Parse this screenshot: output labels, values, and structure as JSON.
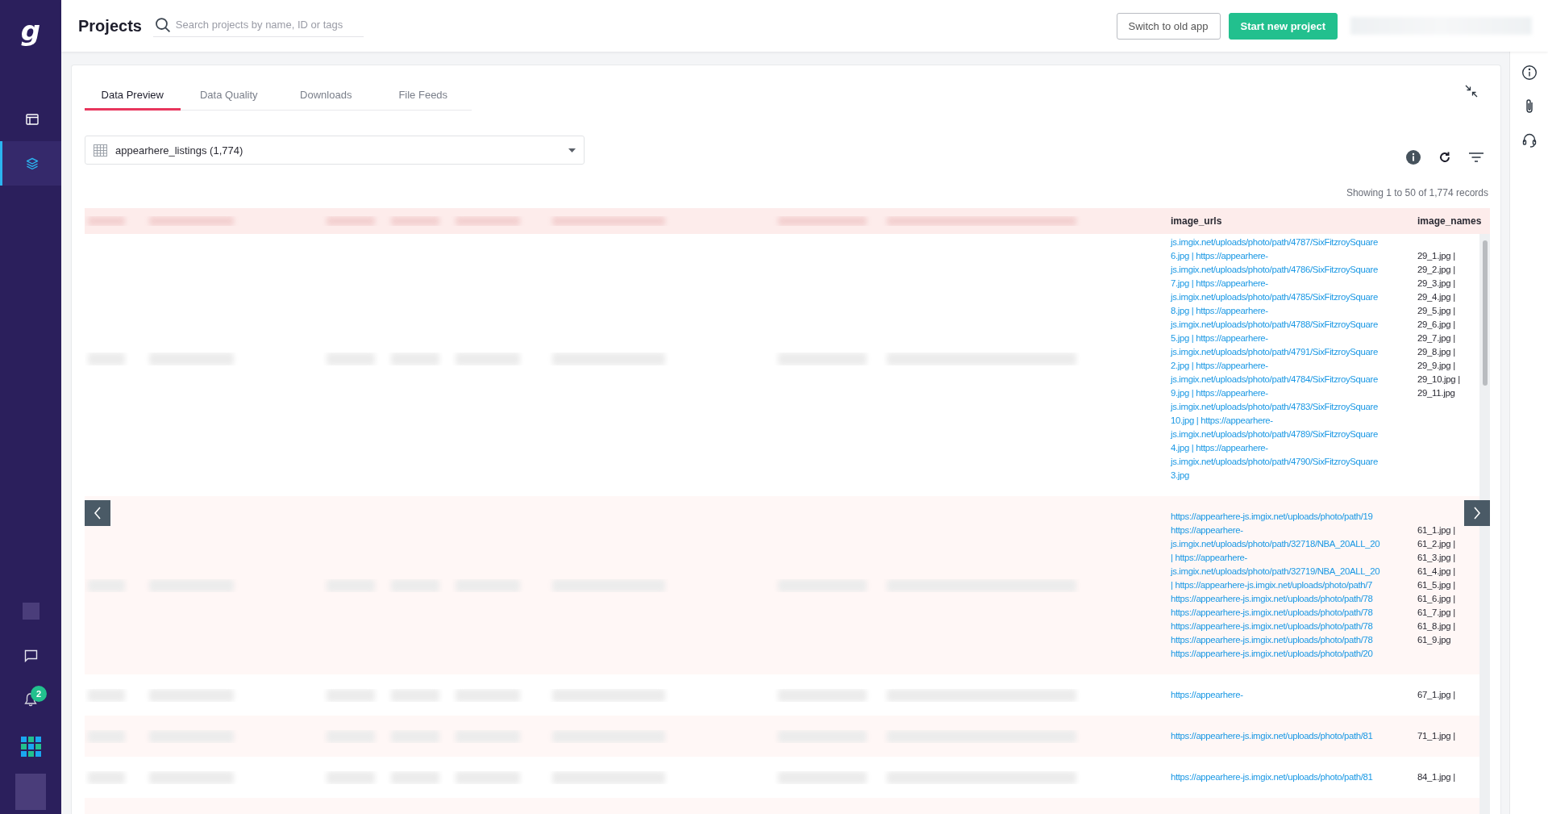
{
  "sidebar": {
    "logo": "g",
    "items": [
      {
        "kind": "layout",
        "selected": false
      },
      {
        "kind": "layers",
        "selected": true
      }
    ],
    "bottom_items": [
      {
        "kind": "photo"
      },
      {
        "kind": "chat"
      },
      {
        "kind": "bell",
        "badge": "2"
      },
      {
        "kind": "apps"
      },
      {
        "kind": "photo"
      }
    ]
  },
  "top_bar": {
    "title": "Projects",
    "search": {
      "placeholder": "Search projects by name, ID or tags"
    },
    "buttons": [
      {
        "label": "Switch to old app",
        "kind": "outline"
      },
      {
        "label": "Start new project",
        "kind": "primary"
      }
    ]
  },
  "tabs": [
    {
      "label": "Data Preview",
      "selected": true
    },
    {
      "label": "Data Quality",
      "selected": false
    },
    {
      "label": "Downloads",
      "selected": false
    },
    {
      "label": "File Feeds",
      "selected": false
    }
  ],
  "dataset_select": {
    "value": "appearhere_listings (1,774)"
  },
  "records_info": "Showing 1 to 50 of 1,774 records",
  "table": {
    "columns": [
      "image_urls",
      "image_names"
    ],
    "rows": [
      {
        "image_urls": [
          "js.imgix.net/uploads/photo/path/4787/SixFitzroySquare",
          "6.jpg | https://appearhere-",
          "js.imgix.net/uploads/photo/path/4786/SixFitzroySquare",
          "7.jpg | https://appearhere-",
          "js.imgix.net/uploads/photo/path/4785/SixFitzroySquare",
          "8.jpg | https://appearhere-",
          "js.imgix.net/uploads/photo/path/4788/SixFitzroySquare",
          "5.jpg | https://appearhere-",
          "js.imgix.net/uploads/photo/path/4791/SixFitzroySquare",
          "2.jpg | https://appearhere-",
          "js.imgix.net/uploads/photo/path/4784/SixFitzroySquare",
          "9.jpg | https://appearhere-",
          "js.imgix.net/uploads/photo/path/4783/SixFitzroySquare",
          "10.jpg | https://appearhere-",
          "js.imgix.net/uploads/photo/path/4789/SixFitzroySquare",
          "4.jpg | https://appearhere-",
          "js.imgix.net/uploads/photo/path/4790/SixFitzroySquare",
          "3.jpg"
        ],
        "image_names": [
          "29_1.jpg |",
          "29_2.jpg |",
          "29_3.jpg |",
          "29_4.jpg |",
          "29_5.jpg |",
          "29_6.jpg |",
          "29_7.jpg |",
          "29_8.jpg |",
          "29_9.jpg |",
          "29_10.jpg |",
          "29_11.jpg"
        ]
      },
      {
        "image_urls": [
          "https://appearhere-js.imgix.net/uploads/photo/path/19",
          "https://appearhere-",
          "js.imgix.net/uploads/photo/path/32718/NBA_20ALL_20",
          "| https://appearhere-",
          "js.imgix.net/uploads/photo/path/32719/NBA_20ALL_20",
          "| https://appearhere-js.imgix.net/uploads/photo/path/7",
          "https://appearhere-js.imgix.net/uploads/photo/path/78",
          "https://appearhere-js.imgix.net/uploads/photo/path/78",
          "https://appearhere-js.imgix.net/uploads/photo/path/78",
          "https://appearhere-js.imgix.net/uploads/photo/path/78",
          "https://appearhere-js.imgix.net/uploads/photo/path/20"
        ],
        "image_names": [
          "61_1.jpg |",
          "61_2.jpg |",
          "61_3.jpg |",
          "61_4.jpg |",
          "61_5.jpg |",
          "61_6.jpg |",
          "61_7.jpg |",
          "61_8.jpg |",
          "61_9.jpg"
        ]
      },
      {
        "image_urls": [
          "https://appearhere-"
        ],
        "image_names": [
          "67_1.jpg |"
        ]
      },
      {
        "image_urls": [
          "https://appearhere-js.imgix.net/uploads/photo/path/81"
        ],
        "image_names": [
          "71_1.jpg |"
        ]
      },
      {
        "image_urls": [
          "https://appearhere-js.imgix.net/uploads/photo/path/81"
        ],
        "image_names": [
          "84_1.jpg |"
        ]
      }
    ]
  }
}
